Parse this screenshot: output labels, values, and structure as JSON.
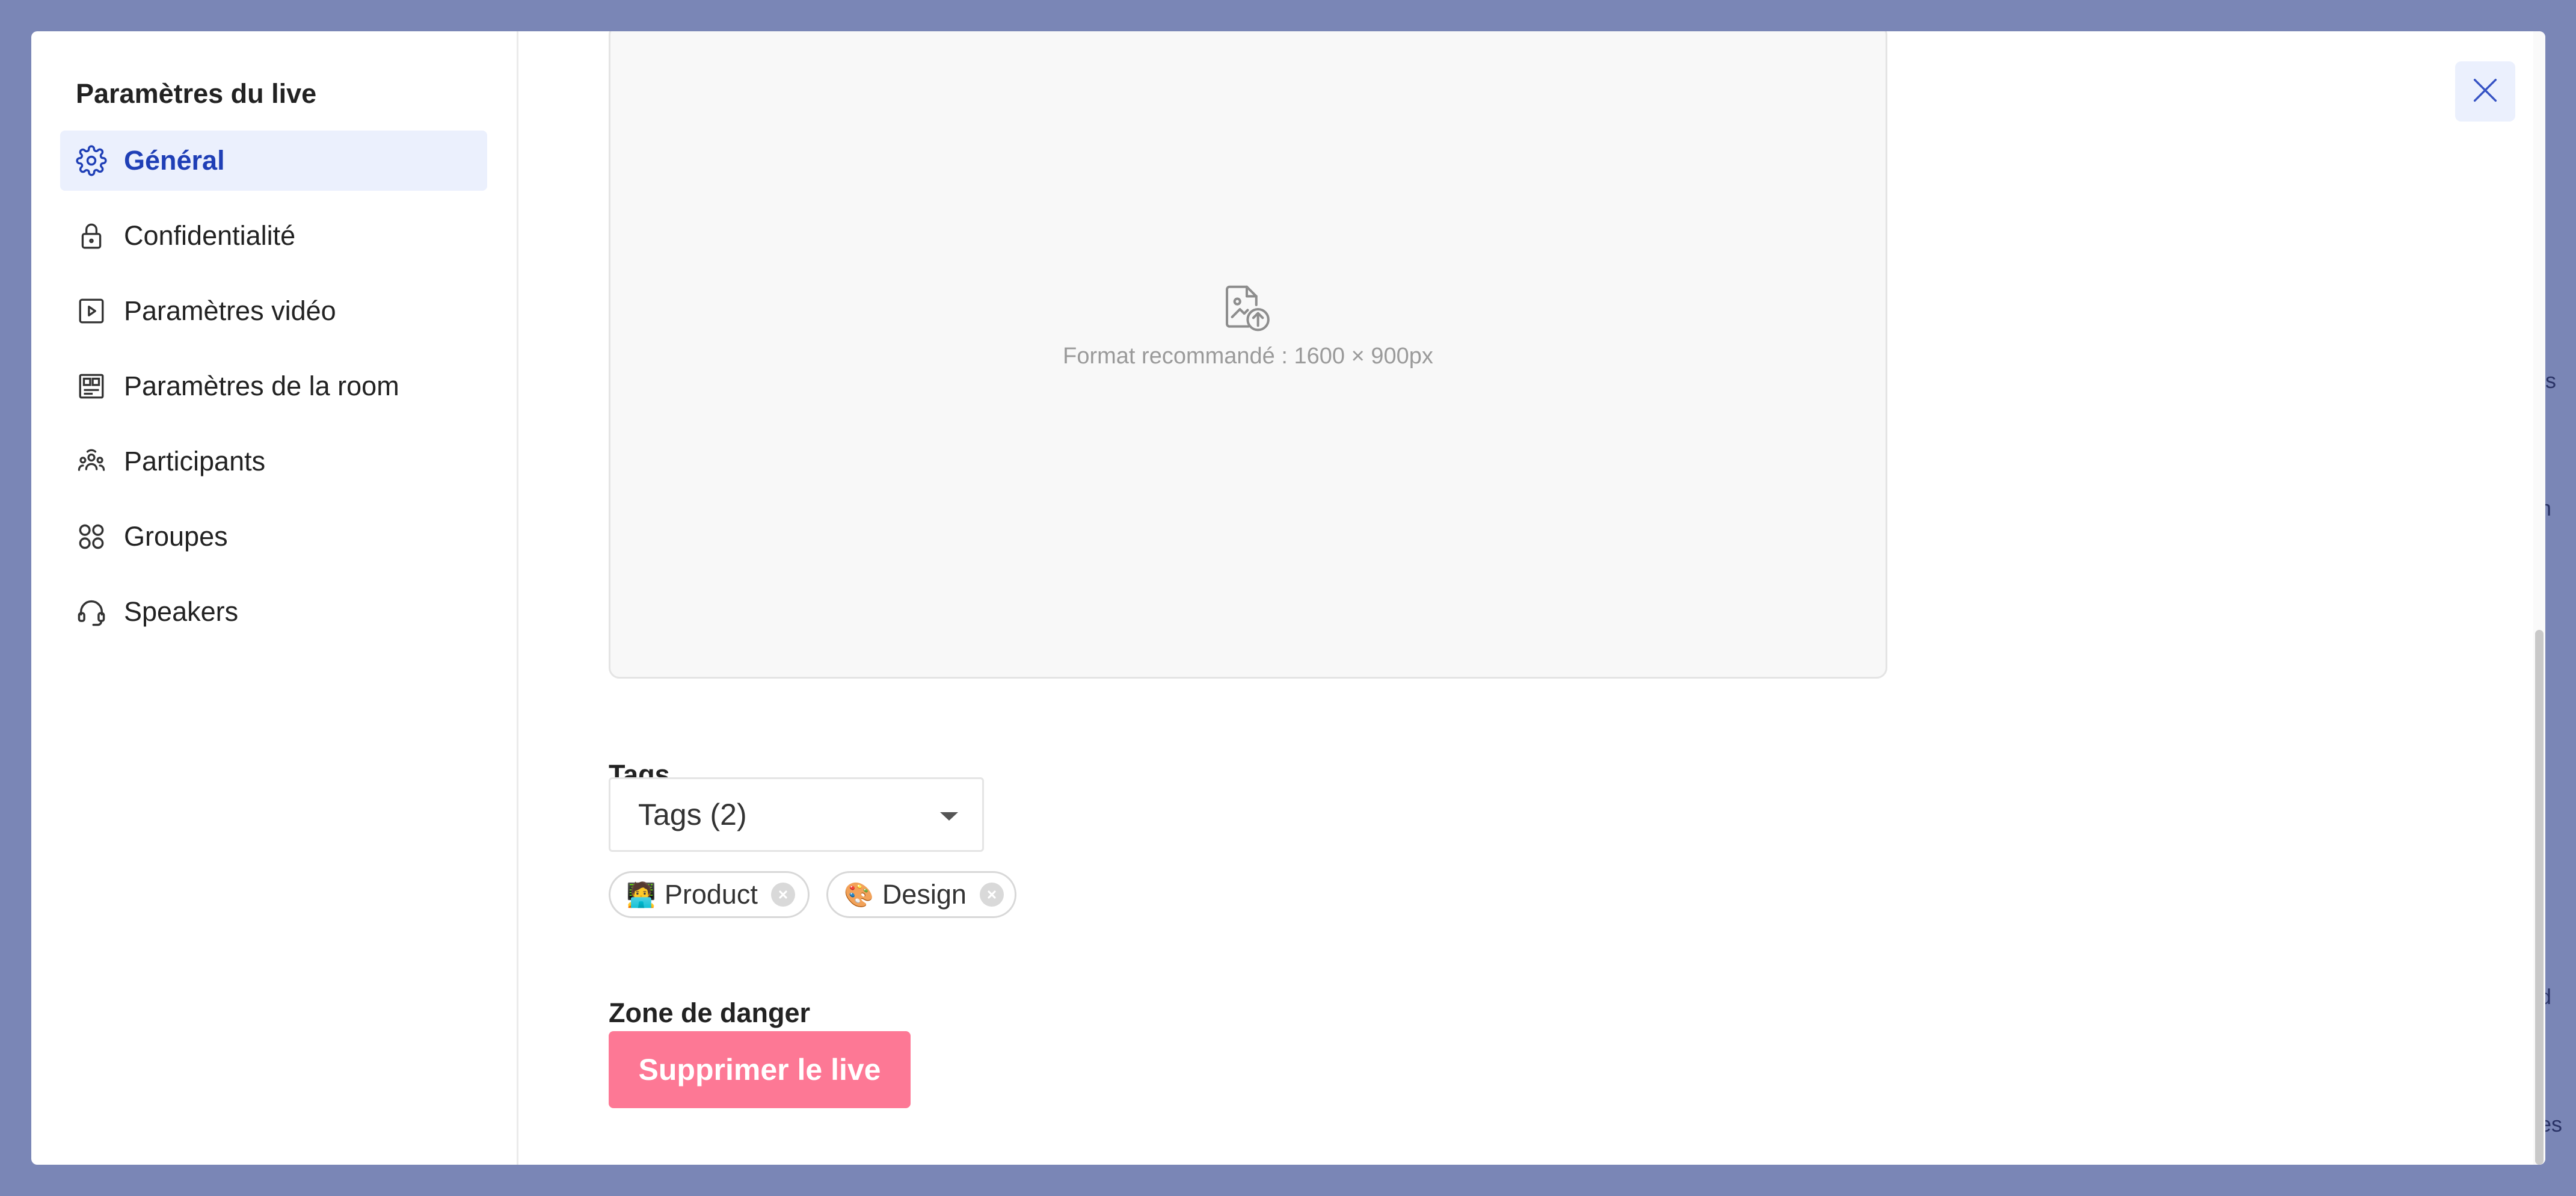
{
  "background_peek": [
    "ts",
    "n",
    "d",
    "es"
  ],
  "sidebar": {
    "title": "Paramètres du live",
    "items": [
      {
        "label": "Général",
        "icon": "gear-icon",
        "active": true
      },
      {
        "label": "Confidentialité",
        "icon": "lock-icon",
        "active": false
      },
      {
        "label": "Paramètres vidéo",
        "icon": "play-square-icon",
        "active": false
      },
      {
        "label": "Paramètres de la room",
        "icon": "room-grid-icon",
        "active": false
      },
      {
        "label": "Participants",
        "icon": "participants-icon",
        "active": false
      },
      {
        "label": "Groupes",
        "icon": "groups-icon",
        "active": false
      },
      {
        "label": "Speakers",
        "icon": "headset-icon",
        "active": false
      }
    ]
  },
  "main": {
    "upload": {
      "hint": "Format recommandé : 1600 × 900px",
      "icon": "image-upload-icon"
    },
    "tags": {
      "label": "Tags",
      "select_value": "Tags (2)",
      "chips": [
        {
          "emoji": "🧑‍💻",
          "label": "Product"
        },
        {
          "emoji": "🎨",
          "label": "Design"
        }
      ]
    },
    "danger": {
      "label": "Zone de danger",
      "button": "Supprimer le live"
    }
  },
  "colors": {
    "accent": "#1f3fb6",
    "active_bg": "#ebf0fd",
    "danger": "#fd7895",
    "overlay": "#7a86b6"
  }
}
